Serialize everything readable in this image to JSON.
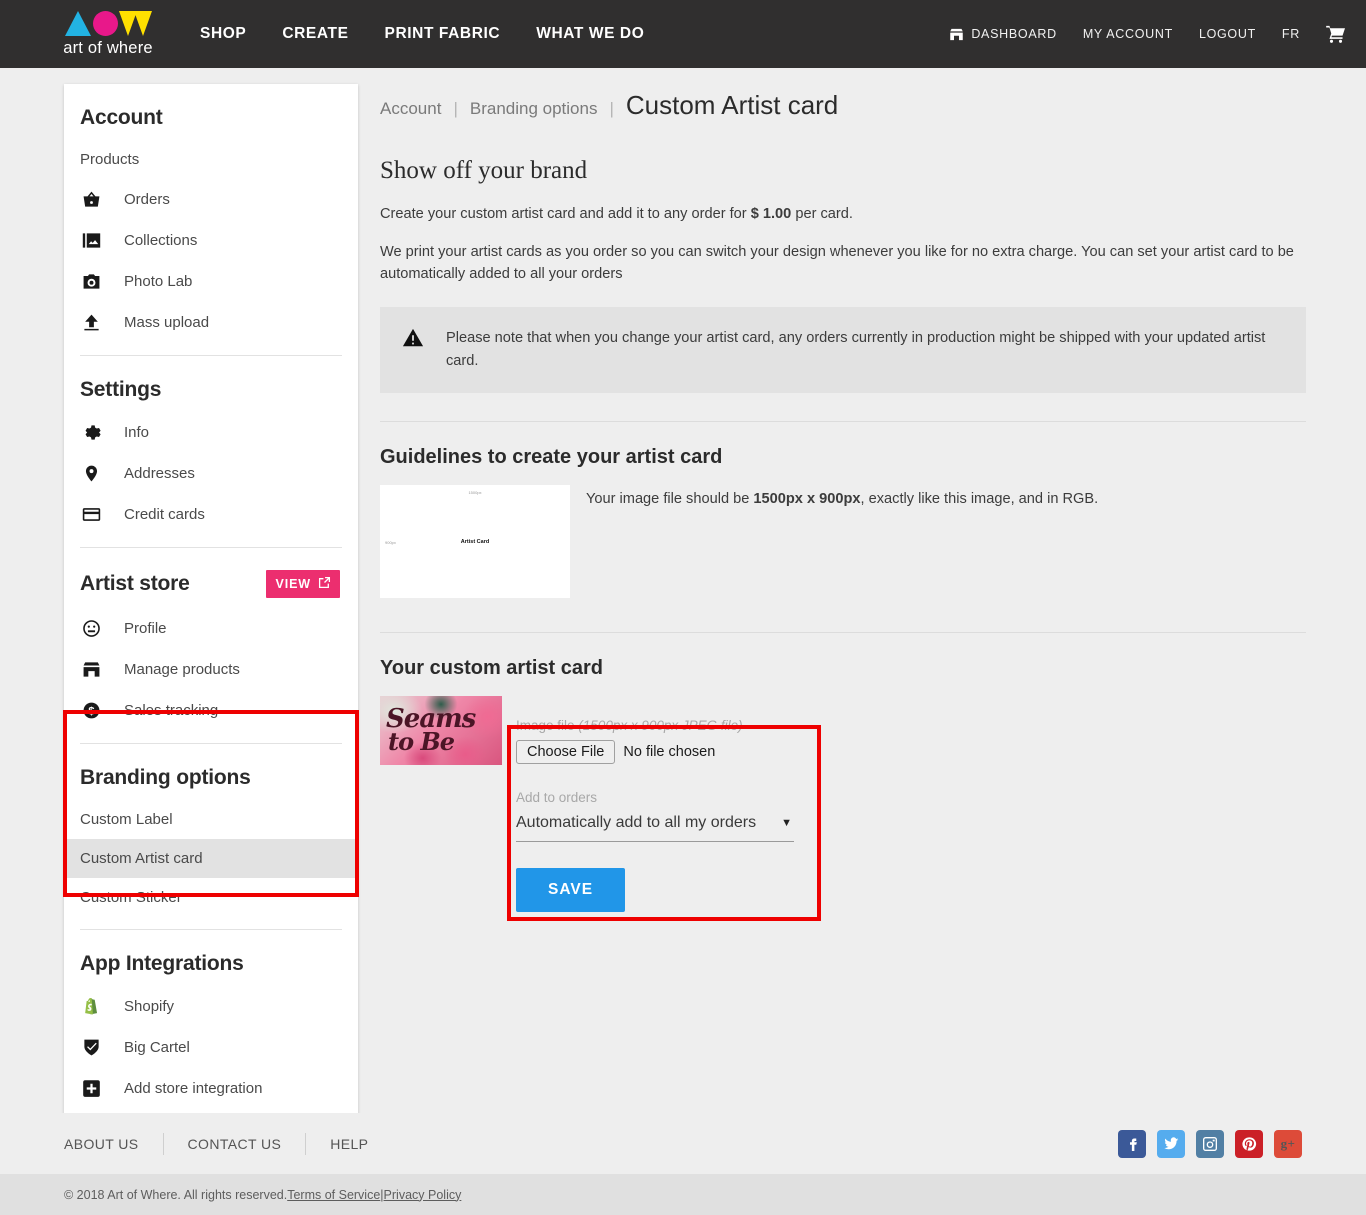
{
  "header": {
    "logo_text": "art of where",
    "nav": [
      {
        "label": "SHOP"
      },
      {
        "label": "CREATE"
      },
      {
        "label": "PRINT FABRIC"
      },
      {
        "label": "WHAT WE DO"
      }
    ],
    "right_nav": [
      {
        "label": "DASHBOARD",
        "icon": "storefront-icon"
      },
      {
        "label": "MY ACCOUNT",
        "icon": ""
      },
      {
        "label": "LOGOUT",
        "icon": ""
      },
      {
        "label": "FR",
        "icon": ""
      }
    ],
    "cart_icon": "shopping-cart-icon"
  },
  "sidebar": {
    "account_heading": "Account",
    "products_label": "Products",
    "product_items": [
      {
        "label": "Orders",
        "icon": "basket-icon"
      },
      {
        "label": "Collections",
        "icon": "images-icon"
      },
      {
        "label": "Photo Lab",
        "icon": "camera-icon"
      },
      {
        "label": "Mass upload",
        "icon": "upload-icon"
      }
    ],
    "settings_heading": "Settings",
    "settings_items": [
      {
        "label": "Info",
        "icon": "gear-icon"
      },
      {
        "label": "Addresses",
        "icon": "map-pin-icon"
      },
      {
        "label": "Credit cards",
        "icon": "credit-card-icon"
      }
    ],
    "artist_store_heading": "Artist store",
    "view_button": "VIEW",
    "view_button_icon": "external-link-icon",
    "artist_store_items": [
      {
        "label": "Profile",
        "icon": "face-icon"
      },
      {
        "label": "Manage products",
        "icon": "storefront-icon"
      },
      {
        "label": "Sales tracking",
        "icon": "dollar-coin-icon"
      }
    ],
    "branding_heading": "Branding options",
    "branding_items": [
      {
        "label": "Custom Label",
        "active": false
      },
      {
        "label": "Custom Artist card",
        "active": true
      },
      {
        "label": "Custom Sticker",
        "active": false
      }
    ],
    "integrations_heading": "App Integrations",
    "integration_items": [
      {
        "label": "Shopify",
        "icon": "shopify-icon"
      },
      {
        "label": "Big Cartel",
        "icon": "big-cartel-icon"
      },
      {
        "label": "Add store integration",
        "icon": "plus-square-icon"
      }
    ]
  },
  "main": {
    "breadcrumb": {
      "level1": "Account",
      "level2": "Branding options",
      "current": "Custom Artist card",
      "separator": "|"
    },
    "intro_title": "Show off your brand",
    "intro_p1_before": "Create your custom artist card and add it to any order for ",
    "intro_p1_price": "$ 1.00",
    "intro_p1_after": " per card.",
    "intro_p2": "We print your artist cards as you order so you can switch your design whenever you like for no extra charge. You can set your artist card to be automatically added to all your orders",
    "notice_icon": "warning-triangle-icon",
    "notice_text": "Please note that when you change your artist card, any orders currently in production might be shipped with your updated artist card.",
    "guidelines_title": "Guidelines to create your artist card",
    "guideline_thumb": {
      "top_label": "1500px",
      "left_label": "900px",
      "center_label": "Artist Card"
    },
    "guidelines_text_before": "Your image file should be ",
    "guidelines_dimensions": "1500px x 900px",
    "guidelines_text_after": ", exactly like this image, and in RGB.",
    "custom_card_title": "Your custom artist card",
    "card_preview": {
      "line1": "Seams",
      "line2": "to Be"
    },
    "form": {
      "image_file_label": "Image file",
      "image_file_hint": "(1500px x 900px JPEG file)",
      "choose_file_button": "Choose File",
      "no_file_text": "No file chosen",
      "add_to_orders_label": "Add to orders",
      "add_to_orders_value": "Automatically add to all my orders",
      "caret_icon": "chevron-down-icon",
      "save_button": "SAVE"
    }
  },
  "footer": {
    "links": [
      {
        "label": "ABOUT US"
      },
      {
        "label": "CONTACT US"
      },
      {
        "label": "HELP"
      }
    ],
    "social": [
      {
        "name": "facebook-icon",
        "glyph": "f",
        "color": "#3b5998"
      },
      {
        "name": "twitter-icon",
        "glyph": "✈",
        "color": "#55acee"
      },
      {
        "name": "instagram-icon",
        "glyph": "▣",
        "color": "#517fa4"
      },
      {
        "name": "pinterest-icon",
        "glyph": "P",
        "color": "#cb2027"
      },
      {
        "name": "google-plus-icon",
        "glyph": "g+",
        "color": "#dd4b39"
      }
    ],
    "copyright_text": "© 2018 Art of Where. All rights reserved. ",
    "terms_link": "Terms of Service",
    "copyright_divider": " | ",
    "privacy_link": "Privacy Policy"
  },
  "colors": {
    "accent_pink": "#ec2e6f",
    "save_blue": "#2196e8",
    "annotation_red": "#ee0000",
    "header_dark": "#302f2f"
  }
}
